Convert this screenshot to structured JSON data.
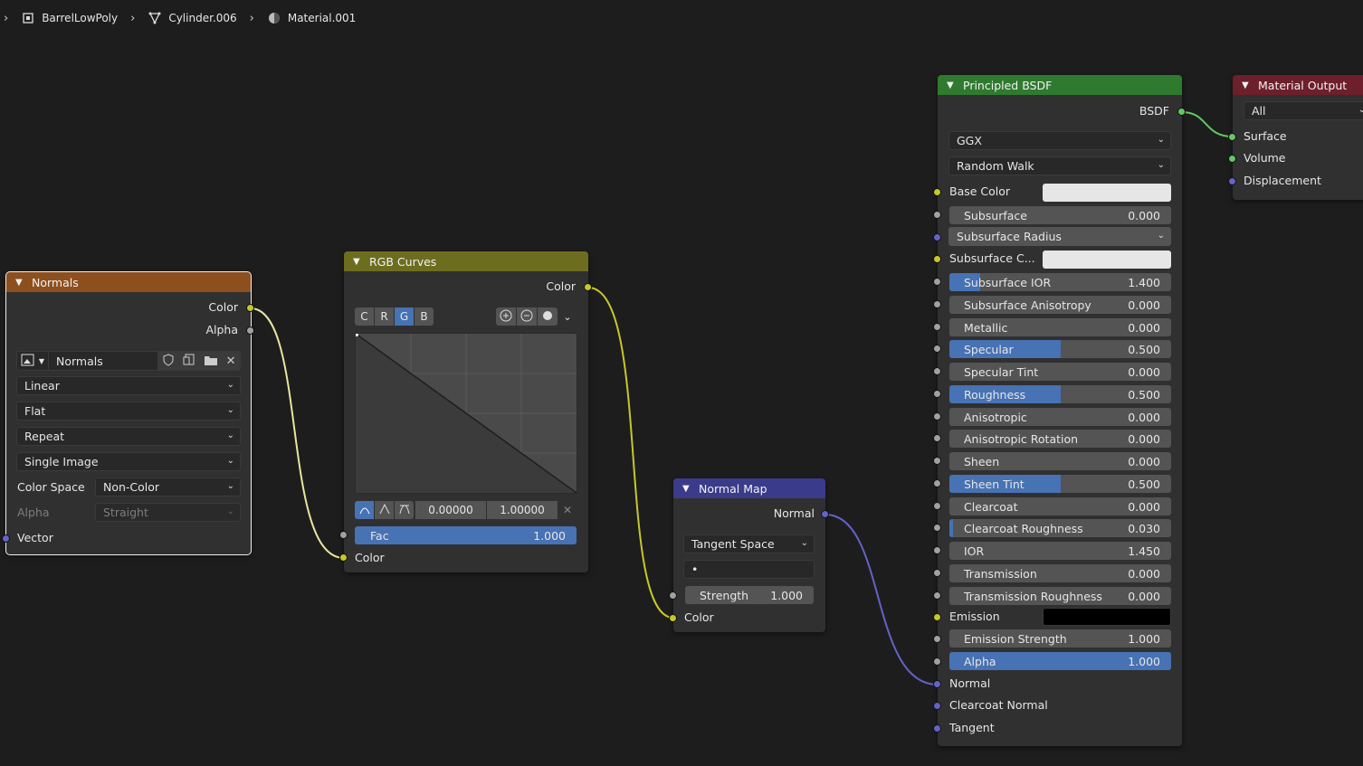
{
  "breadcrumb": [
    {
      "label": "BarrelLowPoly",
      "icon": "object-icon"
    },
    {
      "label": "Cylinder.006",
      "icon": "mesh-icon"
    },
    {
      "label": "Material.001",
      "icon": "material-icon"
    }
  ],
  "colors": {
    "background": "#1d1d1d",
    "node_body": "#303030",
    "image_header": "#8e4f1f",
    "curves_header": "#6d6d1f",
    "vector_header": "#3b3b8b",
    "shader_header": "#2f7a2f",
    "output_header": "#6d1f2b",
    "accent_blue": "#4772b3",
    "socket_yellow": "#c7c729",
    "socket_grey": "#a1a1a1",
    "socket_blue": "#6363c7",
    "socket_green": "#63c763"
  },
  "normals_node": {
    "title": "Normals",
    "outputs": [
      "Color",
      "Alpha"
    ],
    "image_name": "Normals",
    "interpolation": "Linear",
    "projection": "Flat",
    "extension": "Repeat",
    "source": "Single Image",
    "color_space_label": "Color Space",
    "color_space": "Non-Color",
    "alpha_label": "Alpha",
    "alpha_mode": "Straight",
    "input": "Vector"
  },
  "rgb_curves_node": {
    "title": "RGB Curves",
    "output": "Color",
    "channels": [
      "C",
      "R",
      "G",
      "B"
    ],
    "active_channel": "G",
    "point_x": "0.00000",
    "point_y": "1.00000",
    "fac_label": "Fac",
    "fac_value": "1.000",
    "fac_fill": 1.0,
    "input": "Color"
  },
  "normal_map_node": {
    "title": "Normal Map",
    "output": "Normal",
    "space": "Tangent Space",
    "uv_map": "•",
    "strength_label": "Strength",
    "strength_value": "1.000",
    "input": "Color"
  },
  "principled_node": {
    "title": "Principled BSDF",
    "output": "BSDF",
    "distribution": "GGX",
    "subsurface_method": "Random Walk",
    "base_color_label": "Base Color",
    "subsurface_color_label": "Subsurface C...",
    "subsurface_radius_label": "Subsurface Radius",
    "emission_label": "Emission",
    "fields": [
      {
        "label": "Subsurface",
        "value": "0.000",
        "fill": 0.0
      },
      {
        "label": "Subsurface IOR",
        "value": "1.400",
        "fill": 0.14
      },
      {
        "label": "Subsurface Anisotropy",
        "value": "0.000",
        "fill": 0.0
      },
      {
        "label": "Metallic",
        "value": "0.000",
        "fill": 0.0
      },
      {
        "label": "Specular",
        "value": "0.500",
        "fill": 0.5
      },
      {
        "label": "Specular Tint",
        "value": "0.000",
        "fill": 0.0
      },
      {
        "label": "Roughness",
        "value": "0.500",
        "fill": 0.5
      },
      {
        "label": "Anisotropic",
        "value": "0.000",
        "fill": 0.0
      },
      {
        "label": "Anisotropic Rotation",
        "value": "0.000",
        "fill": 0.0
      },
      {
        "label": "Sheen",
        "value": "0.000",
        "fill": 0.0
      },
      {
        "label": "Sheen Tint",
        "value": "0.500",
        "fill": 0.5
      },
      {
        "label": "Clearcoat",
        "value": "0.000",
        "fill": 0.0
      },
      {
        "label": "Clearcoat Roughness",
        "value": "0.030",
        "fill": 0.03
      },
      {
        "label": "IOR",
        "value": "1.450",
        "fill": 0.0
      },
      {
        "label": "Transmission",
        "value": "0.000",
        "fill": 0.0
      },
      {
        "label": "Transmission Roughness",
        "value": "0.000",
        "fill": 0.0
      }
    ],
    "emission_strength": {
      "label": "Emission Strength",
      "value": "1.000",
      "fill": 0.0
    },
    "alpha": {
      "label": "Alpha",
      "value": "1.000",
      "fill": 1.0
    },
    "vector_inputs": [
      "Normal",
      "Clearcoat Normal",
      "Tangent"
    ]
  },
  "material_output_node": {
    "title": "Material Output",
    "target": "All",
    "inputs": [
      "Surface",
      "Volume",
      "Displacement"
    ]
  }
}
